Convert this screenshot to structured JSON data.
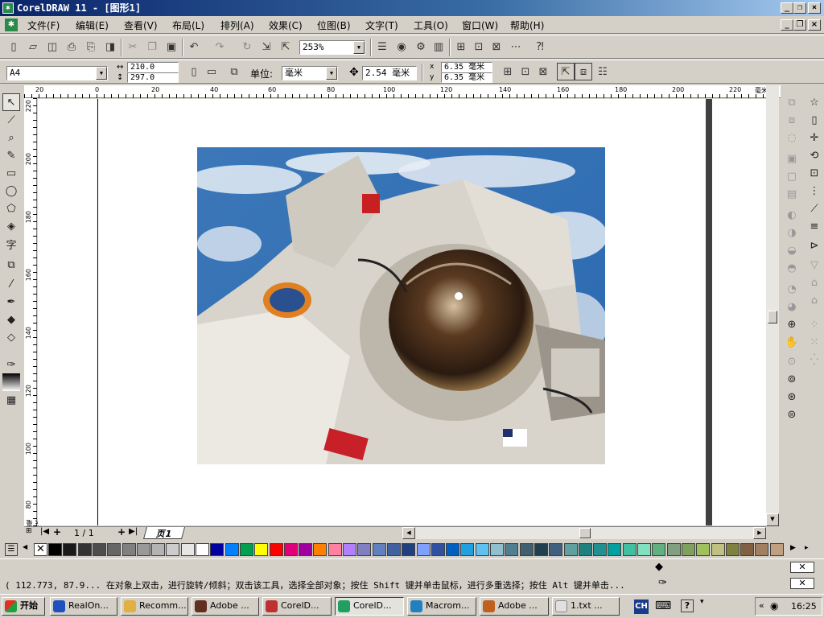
{
  "window": {
    "title": "CorelDRAW 11 - [图形1]",
    "minimize": "_",
    "restore": "❐",
    "close": "×"
  },
  "menu": [
    "文件(F)",
    "编辑(E)",
    "查看(V)",
    "布局(L)",
    "排列(A)",
    "效果(C)",
    "位图(B)",
    "文字(T)",
    "工具(O)",
    "窗口(W)",
    "帮助(H)"
  ],
  "standard_toolbar": {
    "zoom": "253%"
  },
  "property_bar": {
    "paper_size": "A4",
    "width": "210.0",
    "height": "297.0",
    "units_label": "单位:",
    "units_value": "毫米",
    "nudge": "2.54 毫米",
    "dup_x": "6.35 毫米",
    "dup_y": "6.35 毫米",
    "x_label": "x",
    "y_label": "y"
  },
  "ruler": {
    "h_ticks": [
      "20",
      "0",
      "20",
      "40",
      "60",
      "80",
      "100",
      "120",
      "140",
      "160",
      "180",
      "200",
      "220",
      "毫米"
    ],
    "v_ticks": [
      "220",
      "200",
      "180",
      "160",
      "140",
      "120",
      "100",
      "80",
      "毫米"
    ]
  },
  "page_nav": {
    "counter": "1 / 1",
    "tab": "页1"
  },
  "palette_colors": [
    "#000000",
    "#1a1a1a",
    "#333333",
    "#4d4d4d",
    "#666666",
    "#808080",
    "#999999",
    "#b3b3b3",
    "#cccccc",
    "#e6e6e6",
    "#ffffff",
    "#0000a0",
    "#0080ff",
    "#00a050",
    "#ffff00",
    "#ff0000",
    "#e0007a",
    "#a000a0",
    "#ff8000",
    "#ff80a0",
    "#b080ff",
    "#8080c0",
    "#6080c0",
    "#4060a0",
    "#204080",
    "#80a0ff",
    "#3050a0",
    "#0060c0",
    "#20a0e0",
    "#60c0f0",
    "#90c0d0",
    "#508090",
    "#406070",
    "#204050",
    "#406080",
    "#60a0a0",
    "#208080",
    "#209090",
    "#00a0a0",
    "#40c0a0",
    "#80e0c0",
    "#60b080",
    "#80a080",
    "#80a060",
    "#a0c060",
    "#c0c080",
    "#808040",
    "#806040",
    "#a08060",
    "#c0a080"
  ],
  "status": {
    "text": "( 112.773, 87.9... 在对象上双击，进行旋转/倾斜；双击该工具，选择全部对象；按住 Shift 键并单击鼠标，进行多重选择；按住 Alt 键并单击..."
  },
  "taskbar": {
    "start": "开始",
    "tasks": [
      {
        "label": "RealOn...",
        "color": "#2050c0"
      },
      {
        "label": "Recomm...",
        "color": "#e0b040"
      },
      {
        "label": "Adobe ...",
        "color": "#603020"
      },
      {
        "label": "CorelD...",
        "color": "#c03030"
      },
      {
        "label": "CorelD...",
        "color": "#20a060"
      },
      {
        "label": "Macrom...",
        "color": "#2080c0"
      },
      {
        "label": "Adobe ...",
        "color": "#c06020"
      },
      {
        "label": "1.txt ...",
        "color": "#e0e0e0"
      }
    ],
    "lang": "CH",
    "help": "?",
    "clock": "16:25"
  }
}
